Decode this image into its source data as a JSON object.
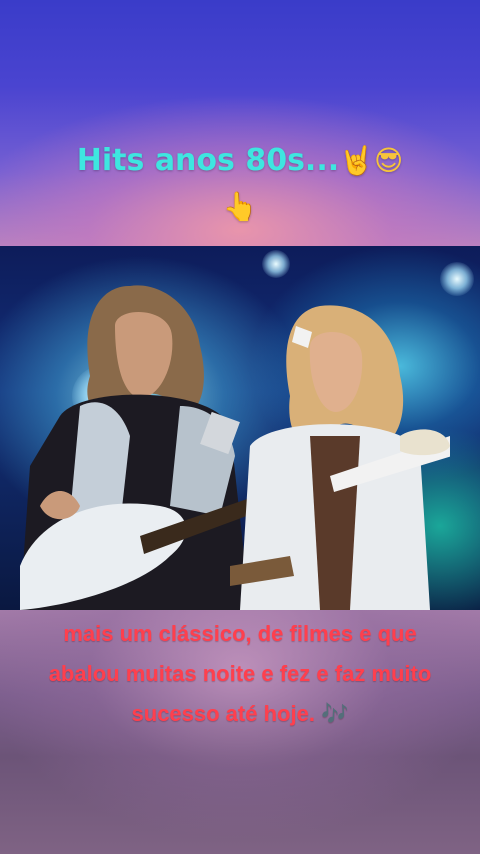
{
  "headline": {
    "text": "Hits anos 80s...",
    "emojis": [
      "🤘",
      "😎",
      "👆"
    ]
  },
  "video": {
    "description_icon": "concert-photo"
  },
  "caption": {
    "text": "mais um clássico, de filmes e que abalou muitas noite e fez e faz muito sucesso até hoje.",
    "emoji": "🎶"
  },
  "colors": {
    "headline": "#3ee6e0",
    "caption": "#ff3f4d",
    "top_gradient": "#3a3cc9",
    "bottom_gradient": "#7d5f8e"
  }
}
